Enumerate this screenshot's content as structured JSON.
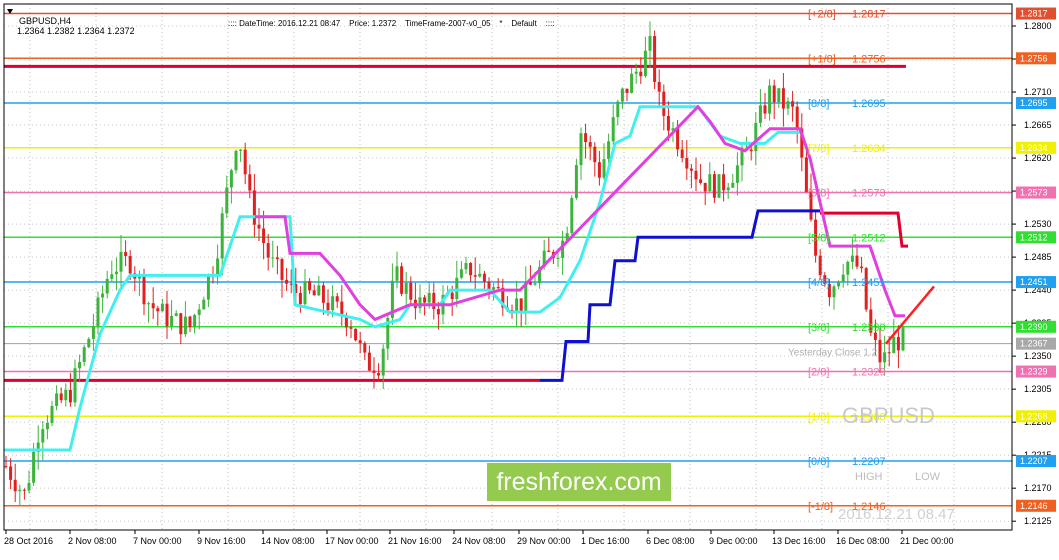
{
  "header": {
    "symbol_timeframe": "GBPUSD,H4",
    "ohlc": "1.2364 1.2382 1.2364 1.2372",
    "info": ":::: DateTime: 2016.12.21 08:47    Price: 1.2372    TimeFrame-2007-v0_05    *    Default    ::::"
  },
  "watermark": "freshforex.com",
  "overlay": {
    "symbol": "GBPUSD",
    "high_label": "HIGH",
    "low_label": "LOW",
    "timestamp": "2016.12.21 08.47",
    "yesterday_close": "Yesterday Close 1.2"
  },
  "colors": {
    "up_candle": "#3cb43c",
    "down_candle": "#e02020",
    "cyan_line": "#40f0f0",
    "magenta_line": "#e040e0",
    "blue_line": "#1010d0",
    "red_level": "#e00030"
  },
  "price_axis": {
    "ticks": [
      "1.2800",
      "1.2755",
      "1.2710",
      "1.2665",
      "1.2620",
      "1.2575",
      "1.2530",
      "1.2485",
      "1.2440",
      "1.2395",
      "1.2350",
      "1.2305",
      "1.2260",
      "1.2215",
      "1.2170",
      "1.2125"
    ],
    "current_price": "1.2367"
  },
  "time_axis": {
    "labels": [
      "28 Oct 2016",
      "2 Nov 08:00",
      "7 Nov 00:00",
      "9 Nov 16:00",
      "14 Nov 08:00",
      "17 Nov 00:00",
      "21 Nov 16:00",
      "24 Nov 08:00",
      "29 Nov 00:00",
      "1 Dec 16:00",
      "6 Dec 08:00",
      "9 Dec 00:00",
      "13 Dec 16:00",
      "16 Dec 08:00",
      "21 Dec 00:00"
    ]
  },
  "murrey_levels": [
    {
      "label": "[+2/8]",
      "price": "1.2817",
      "color": "#e05030"
    },
    {
      "label": "[+1/8]",
      "price": "1.2756",
      "color": "#f06020"
    },
    {
      "label": "[8/8]",
      "price": "1.2695",
      "color": "#20a0f0"
    },
    {
      "label": "[7/8]",
      "price": "1.2634",
      "color": "#f0f000"
    },
    {
      "label": "[6/8]",
      "price": "1.2573",
      "color": "#f070b0"
    },
    {
      "label": "[5/8]",
      "price": "1.2512",
      "color": "#30e030"
    },
    {
      "label": "[4/8]",
      "price": "1.2451",
      "color": "#20a0f0"
    },
    {
      "label": "[3/8]",
      "price": "1.2390",
      "color": "#30e030"
    },
    {
      "label": "[2/8]",
      "price": "1.2329",
      "color": "#f070b0"
    },
    {
      "label": "[1/8]",
      "price": "1.2268",
      "color": "#f0f000"
    },
    {
      "label": "[0/8]",
      "price": "1.2207",
      "color": "#20a0f0"
    },
    {
      "label": "[-1/8]",
      "price": "1.2146",
      "color": "#f06020"
    }
  ]
}
